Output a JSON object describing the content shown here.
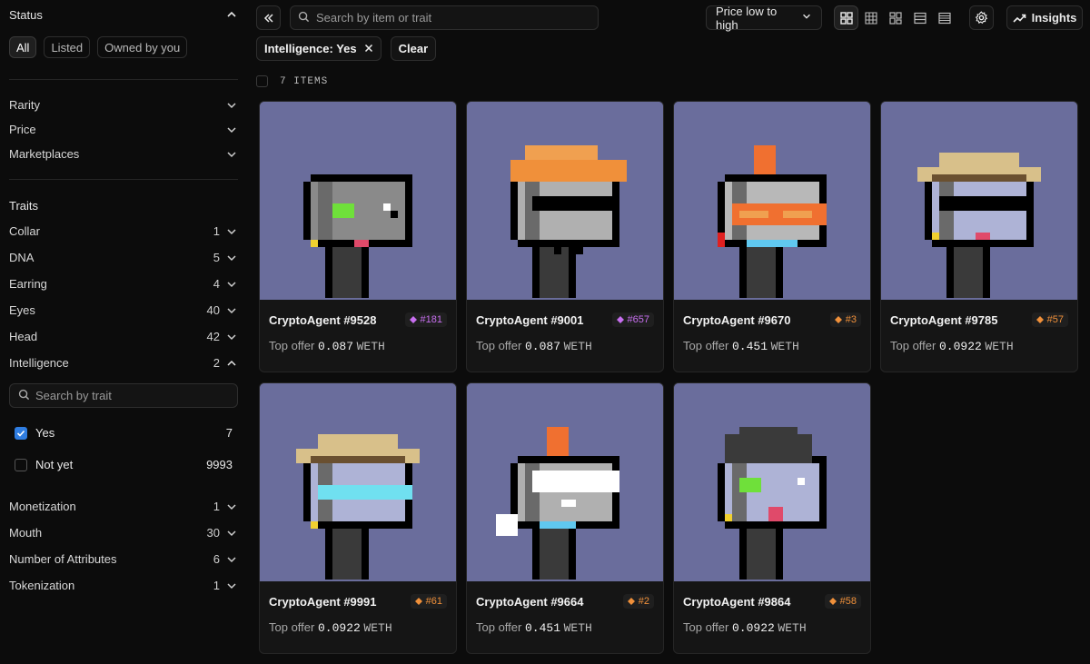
{
  "sidebar": {
    "status": {
      "title": "Status",
      "filters": [
        "All",
        "Listed",
        "Owned by you"
      ]
    },
    "sections": [
      "Rarity",
      "Price",
      "Marketplaces"
    ],
    "traits_title": "Traits",
    "traits_before": [
      {
        "label": "Collar",
        "count": "1"
      },
      {
        "label": "DNA",
        "count": "5"
      },
      {
        "label": "Earring",
        "count": "4"
      },
      {
        "label": "Eyes",
        "count": "40"
      },
      {
        "label": "Head",
        "count": "42"
      }
    ],
    "intelligence": {
      "label": "Intelligence",
      "count": "2",
      "search_placeholder": "Search by trait",
      "options": [
        {
          "label": "Yes",
          "count": "7",
          "checked": true
        },
        {
          "label": "Not yet",
          "count": "9993",
          "checked": false
        }
      ]
    },
    "traits_after": [
      {
        "label": "Monetization",
        "count": "1"
      },
      {
        "label": "Mouth",
        "count": "30"
      },
      {
        "label": "Number of Attributes",
        "count": "6"
      },
      {
        "label": "Tokenization",
        "count": "1"
      }
    ]
  },
  "toolbar": {
    "search_placeholder": "Search by item or trait",
    "sort_label": "Price low to high",
    "insights_label": "Insights"
  },
  "chips": {
    "active_filter": "Intelligence: Yes",
    "clear_label": "Clear"
  },
  "items_count": "7 ITEMS",
  "colors": {
    "accent_purple": "#c86ff0",
    "accent_orange": "#f0903a",
    "card_bg": "#6a6d9c",
    "checkbox_blue": "#2f7de1"
  },
  "cards": [
    {
      "name": "CryptoAgent #9528",
      "rank": "#181",
      "rank_color": "purple",
      "offer_label": "Top offer",
      "offer": "0.087",
      "currency": "WETH"
    },
    {
      "name": "CryptoAgent #9001",
      "rank": "#657",
      "rank_color": "purple",
      "offer_label": "Top offer",
      "offer": "0.087",
      "currency": "WETH"
    },
    {
      "name": "CryptoAgent #9670",
      "rank": "#3",
      "rank_color": "orange",
      "offer_label": "Top offer",
      "offer": "0.451",
      "currency": "WETH"
    },
    {
      "name": "CryptoAgent #9785",
      "rank": "#57",
      "rank_color": "orange",
      "offer_label": "Top offer",
      "offer": "0.0922",
      "currency": "WETH"
    },
    {
      "name": "CryptoAgent #9991",
      "rank": "#61",
      "rank_color": "orange",
      "offer_label": "Top offer",
      "offer": "0.0922",
      "currency": "WETH"
    },
    {
      "name": "CryptoAgent #9664",
      "rank": "#2",
      "rank_color": "orange",
      "offer_label": "Top offer",
      "offer": "0.451",
      "currency": "WETH"
    },
    {
      "name": "CryptoAgent #9864",
      "rank": "#58",
      "rank_color": "orange",
      "offer_label": "Top offer",
      "offer": "0.0922",
      "currency": "WETH"
    }
  ]
}
